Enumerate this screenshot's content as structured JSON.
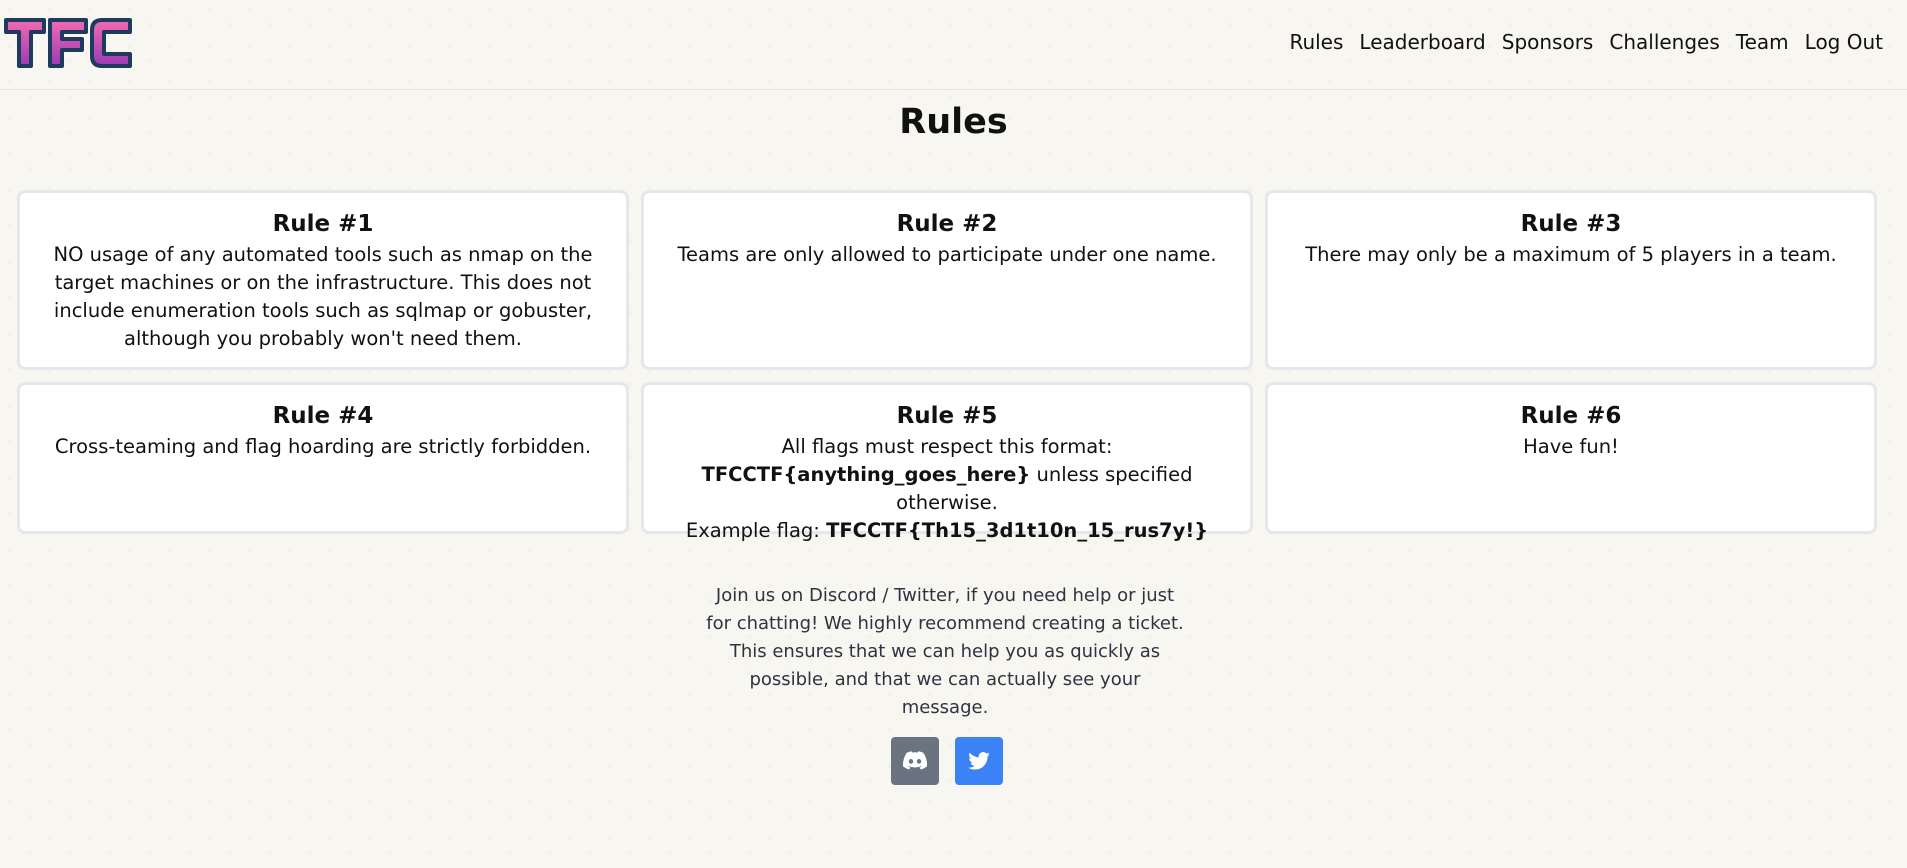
{
  "brand": {
    "logo_text": "TFC"
  },
  "nav": {
    "items": [
      "Rules",
      "Leaderboard",
      "Sponsors",
      "Challenges",
      "Team",
      "Log Out"
    ]
  },
  "page": {
    "title": "Rules"
  },
  "rules": [
    {
      "title": "Rule #1",
      "text": "NO usage of any automated tools such as nmap on the target machines or on the infrastructure. This does not include enumeration tools such as sqlmap or gobuster, although you probably won't need them."
    },
    {
      "title": "Rule #2",
      "text": "Teams are only allowed to participate under one name."
    },
    {
      "title": "Rule #3",
      "text": "There may only be a maximum of 5 players in a team."
    },
    {
      "title": "Rule #4",
      "text": "Cross-teaming and flag hoarding are strictly forbidden."
    },
    {
      "title": "Rule #5",
      "text_intro": "All flags must respect this format:",
      "format": "TFCCTF{anything_goes_here}",
      "text_mid": " unless specified otherwise.",
      "example_label": "Example flag: ",
      "example": "TFCCTF{Th15_3d1t10n_15_rus7y!}"
    },
    {
      "title": "Rule #6",
      "text": "Have fun!"
    }
  ],
  "footer": {
    "text": "Join us on Discord / Twitter, if you need help or just for chatting! We highly recommend creating a ticket. This ensures that we can help you as quickly as possible, and that we can actually see your message.",
    "discord_icon": "discord-icon",
    "twitter_icon": "twitter-icon"
  },
  "colors": {
    "discord_button": "#6b7280",
    "twitter_button": "#3b82f6",
    "logo_fill": "#c0479e",
    "logo_outline": "#1f3a5f"
  }
}
